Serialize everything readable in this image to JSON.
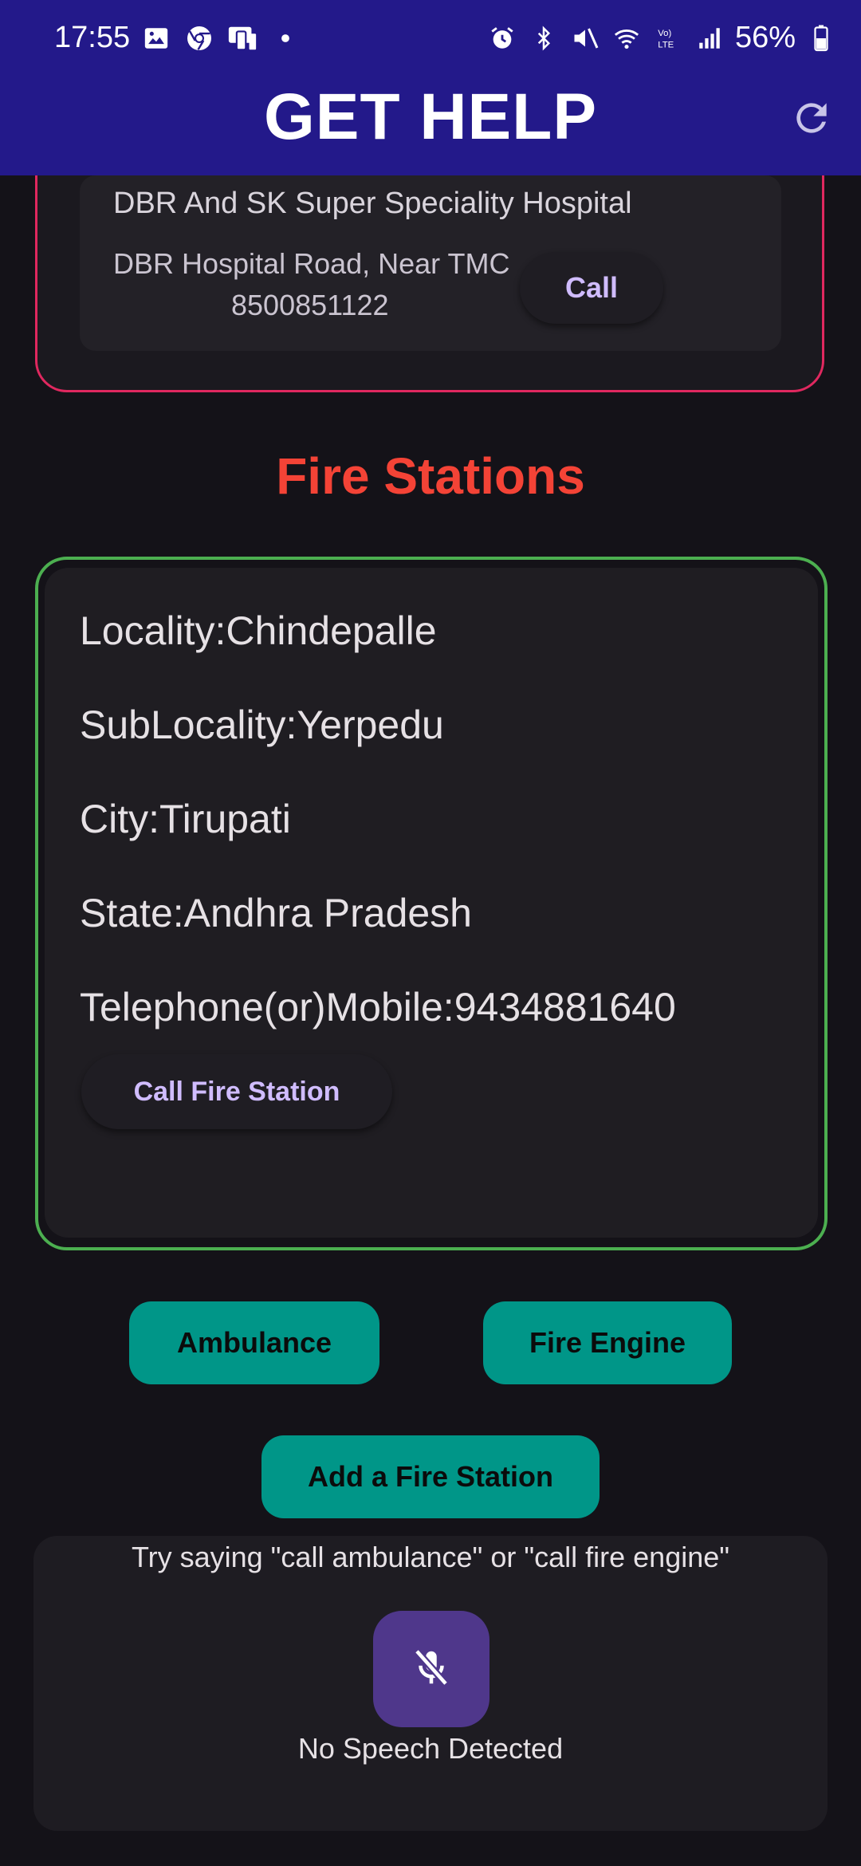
{
  "status_bar": {
    "time": "17:55",
    "battery": "56%",
    "left_icons": [
      "gallery-icon",
      "chrome-icon",
      "screen-share-icon",
      "dot-icon"
    ],
    "right_icons": [
      "alarm-icon",
      "bluetooth-icon",
      "mute-icon",
      "wifi-icon",
      "volte-icon",
      "signal-icon",
      "battery-icon"
    ]
  },
  "app_bar": {
    "title": "GET HELP",
    "refresh_icon": "refresh-icon"
  },
  "hospital": {
    "name": "DBR And SK Super Speciality Hospital",
    "address": "DBR Hospital Road, Near TMC",
    "phone": "8500851122",
    "call_label": "Call"
  },
  "fire_section": {
    "title": "Fire Stations",
    "locality": "Locality:Chindepalle",
    "sublocality": "SubLocality:Yerpedu",
    "city": "City:Tirupati",
    "state": "State:Andhra Pradesh",
    "telephone": "Telephone(or)Mobile:9434881640",
    "call_label": "Call Fire Station"
  },
  "actions": {
    "ambulance": "Ambulance",
    "fire_engine": "Fire Engine",
    "add_fire_station": "Add a Fire Station"
  },
  "speech": {
    "hint": "Try saying \"call ambulance\" or \"call fire engine\"",
    "status": "No Speech Detected",
    "mic_icon": "mic-off-icon"
  },
  "colors": {
    "app_bar": "#23198a",
    "background": "#141218",
    "hospital_border": "#e0285f",
    "fire_border": "#4caf50",
    "section_title": "#f44336",
    "teal_button": "#009688",
    "accent_text": "#d0bcff",
    "mic_button": "#4f378b"
  }
}
